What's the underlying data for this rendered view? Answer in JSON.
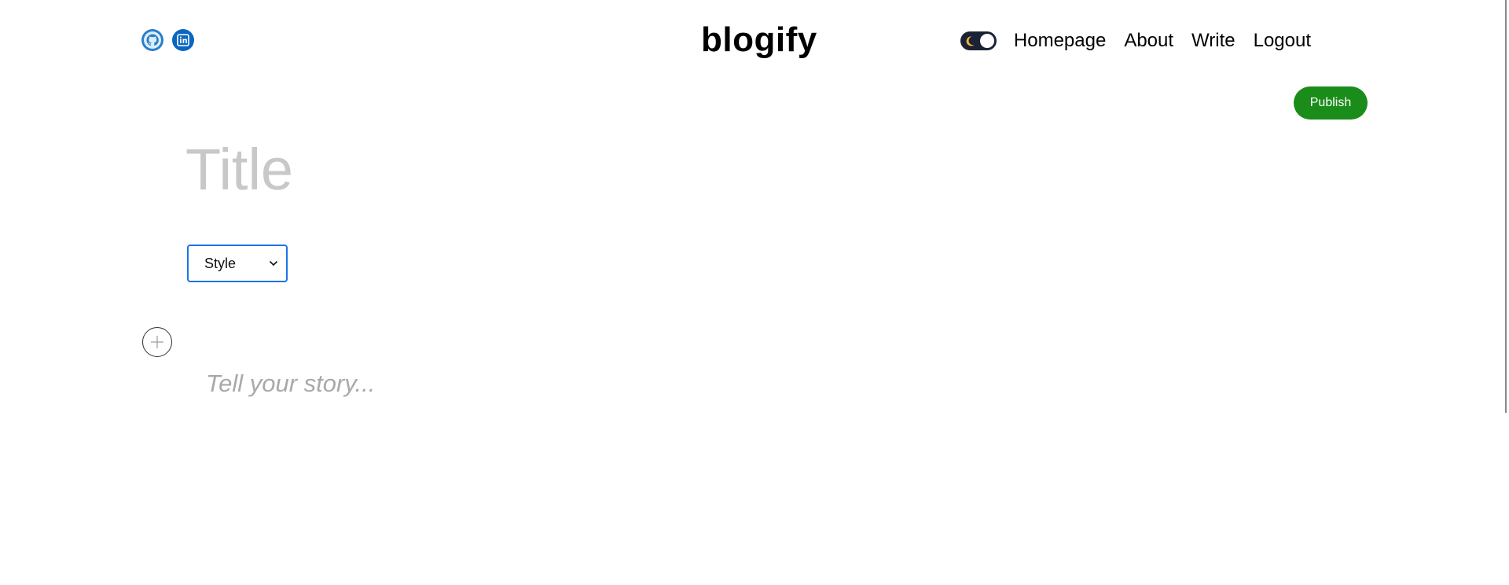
{
  "header": {
    "logo_text": "blogify",
    "social": [
      {
        "name": "github-icon"
      },
      {
        "name": "linkedin-icon"
      }
    ],
    "theme_toggle": {
      "state": "dark",
      "icon": "moon-icon"
    },
    "nav": [
      {
        "label": "Homepage"
      },
      {
        "label": "About"
      },
      {
        "label": "Write"
      },
      {
        "label": "Logout"
      }
    ]
  },
  "editor": {
    "publish_label": "Publish",
    "title_placeholder": "Title",
    "style_select": {
      "selected": "Style"
    },
    "add_block_icon": "plus-icon",
    "story_placeholder": "Tell your story..."
  },
  "colors": {
    "publish_bg": "#1a8c1a",
    "toggle_bg": "#1c2235",
    "select_border": "#1a73e8"
  }
}
